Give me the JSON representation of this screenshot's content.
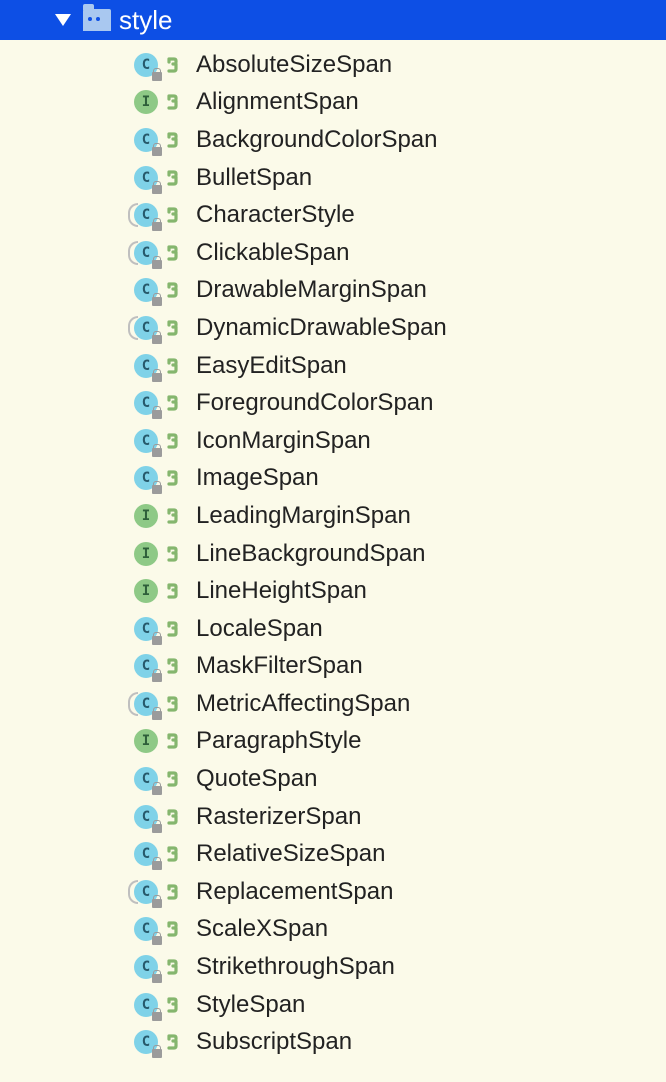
{
  "package": {
    "name": "style"
  },
  "items": [
    {
      "type": "C",
      "abstract": false,
      "locked": true,
      "label": "AbsoluteSizeSpan"
    },
    {
      "type": "I",
      "abstract": false,
      "locked": false,
      "label": "AlignmentSpan"
    },
    {
      "type": "C",
      "abstract": false,
      "locked": true,
      "label": "BackgroundColorSpan"
    },
    {
      "type": "C",
      "abstract": false,
      "locked": true,
      "label": "BulletSpan"
    },
    {
      "type": "C",
      "abstract": true,
      "locked": true,
      "label": "CharacterStyle"
    },
    {
      "type": "C",
      "abstract": true,
      "locked": true,
      "label": "ClickableSpan"
    },
    {
      "type": "C",
      "abstract": false,
      "locked": true,
      "label": "DrawableMarginSpan"
    },
    {
      "type": "C",
      "abstract": true,
      "locked": true,
      "label": "DynamicDrawableSpan"
    },
    {
      "type": "C",
      "abstract": false,
      "locked": true,
      "label": "EasyEditSpan"
    },
    {
      "type": "C",
      "abstract": false,
      "locked": true,
      "label": "ForegroundColorSpan"
    },
    {
      "type": "C",
      "abstract": false,
      "locked": true,
      "label": "IconMarginSpan"
    },
    {
      "type": "C",
      "abstract": false,
      "locked": true,
      "label": "ImageSpan"
    },
    {
      "type": "I",
      "abstract": false,
      "locked": false,
      "label": "LeadingMarginSpan"
    },
    {
      "type": "I",
      "abstract": false,
      "locked": false,
      "label": "LineBackgroundSpan"
    },
    {
      "type": "I",
      "abstract": false,
      "locked": false,
      "label": "LineHeightSpan"
    },
    {
      "type": "C",
      "abstract": false,
      "locked": true,
      "label": "LocaleSpan"
    },
    {
      "type": "C",
      "abstract": false,
      "locked": true,
      "label": "MaskFilterSpan"
    },
    {
      "type": "C",
      "abstract": true,
      "locked": true,
      "label": "MetricAffectingSpan"
    },
    {
      "type": "I",
      "abstract": false,
      "locked": false,
      "label": "ParagraphStyle"
    },
    {
      "type": "C",
      "abstract": false,
      "locked": true,
      "label": "QuoteSpan"
    },
    {
      "type": "C",
      "abstract": false,
      "locked": true,
      "label": "RasterizerSpan"
    },
    {
      "type": "C",
      "abstract": false,
      "locked": true,
      "label": "RelativeSizeSpan"
    },
    {
      "type": "C",
      "abstract": true,
      "locked": true,
      "label": "ReplacementSpan"
    },
    {
      "type": "C",
      "abstract": false,
      "locked": true,
      "label": "ScaleXSpan"
    },
    {
      "type": "C",
      "abstract": false,
      "locked": true,
      "label": "StrikethroughSpan"
    },
    {
      "type": "C",
      "abstract": false,
      "locked": true,
      "label": "StyleSpan"
    },
    {
      "type": "C",
      "abstract": false,
      "locked": true,
      "label": "SubscriptSpan"
    }
  ]
}
